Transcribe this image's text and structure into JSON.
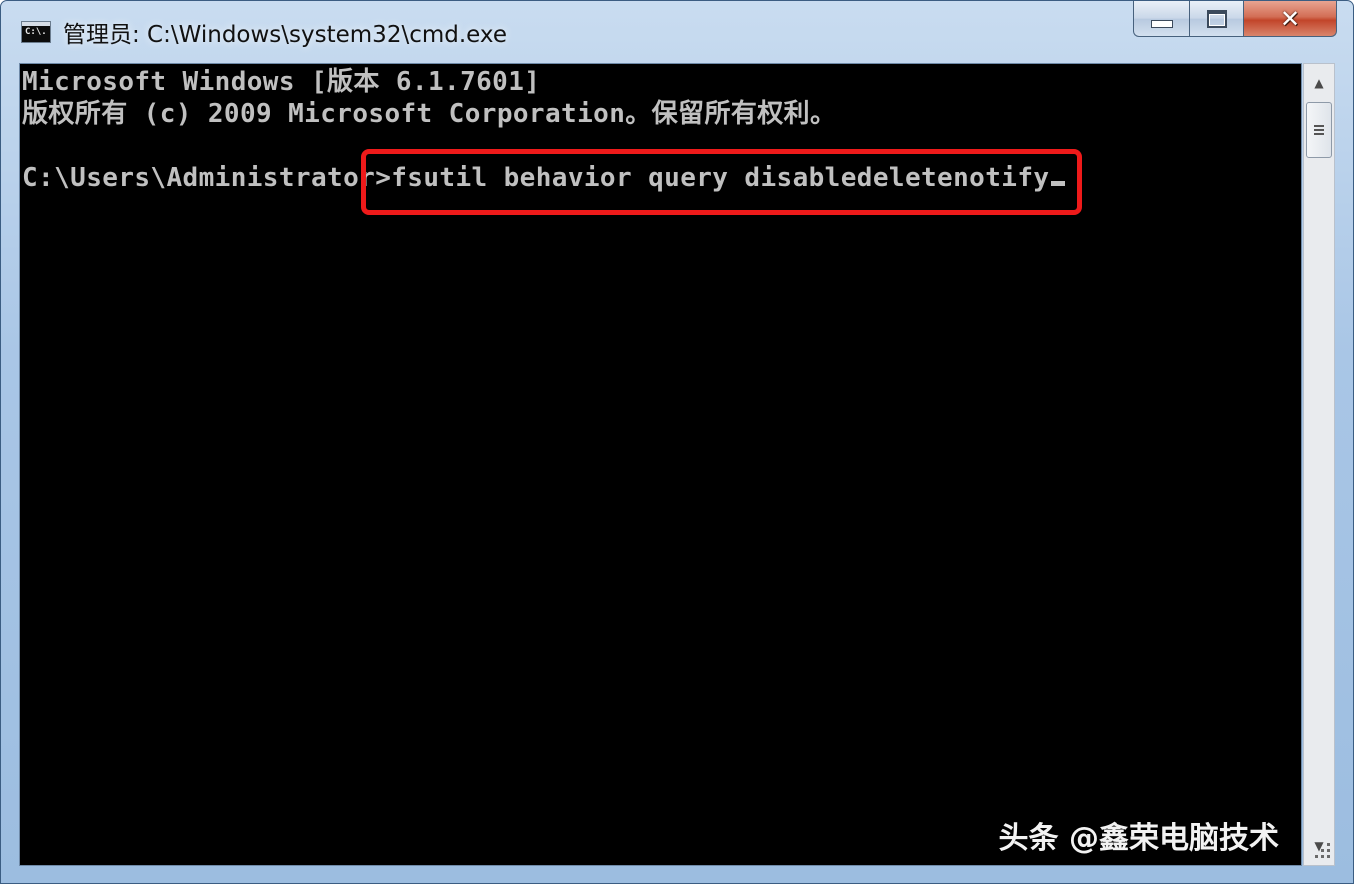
{
  "window": {
    "title": "管理员: C:\\Windows\\system32\\cmd.exe",
    "icon_label": "C:\\.",
    "buttons": {
      "minimize": "minimize",
      "maximize": "maximize",
      "close": "✕"
    }
  },
  "console": {
    "lines": [
      "Microsoft Windows [版本 6.1.7601]",
      "版权所有 (c) 2009 Microsoft Corporation。保留所有权利。",
      ""
    ],
    "prompt": "C:\\Users\\Administrator",
    "command": ">fsutil behavior query disabledeletenotify",
    "text_color": "#c0c0c0",
    "background": "#000000"
  },
  "highlight": {
    "color": "#ee1a1a",
    "target": "command"
  },
  "watermark": {
    "text": "头条 @鑫荣电脑技术"
  },
  "scrollbar": {
    "up_arrow": "▲",
    "down_arrow": "▼"
  }
}
